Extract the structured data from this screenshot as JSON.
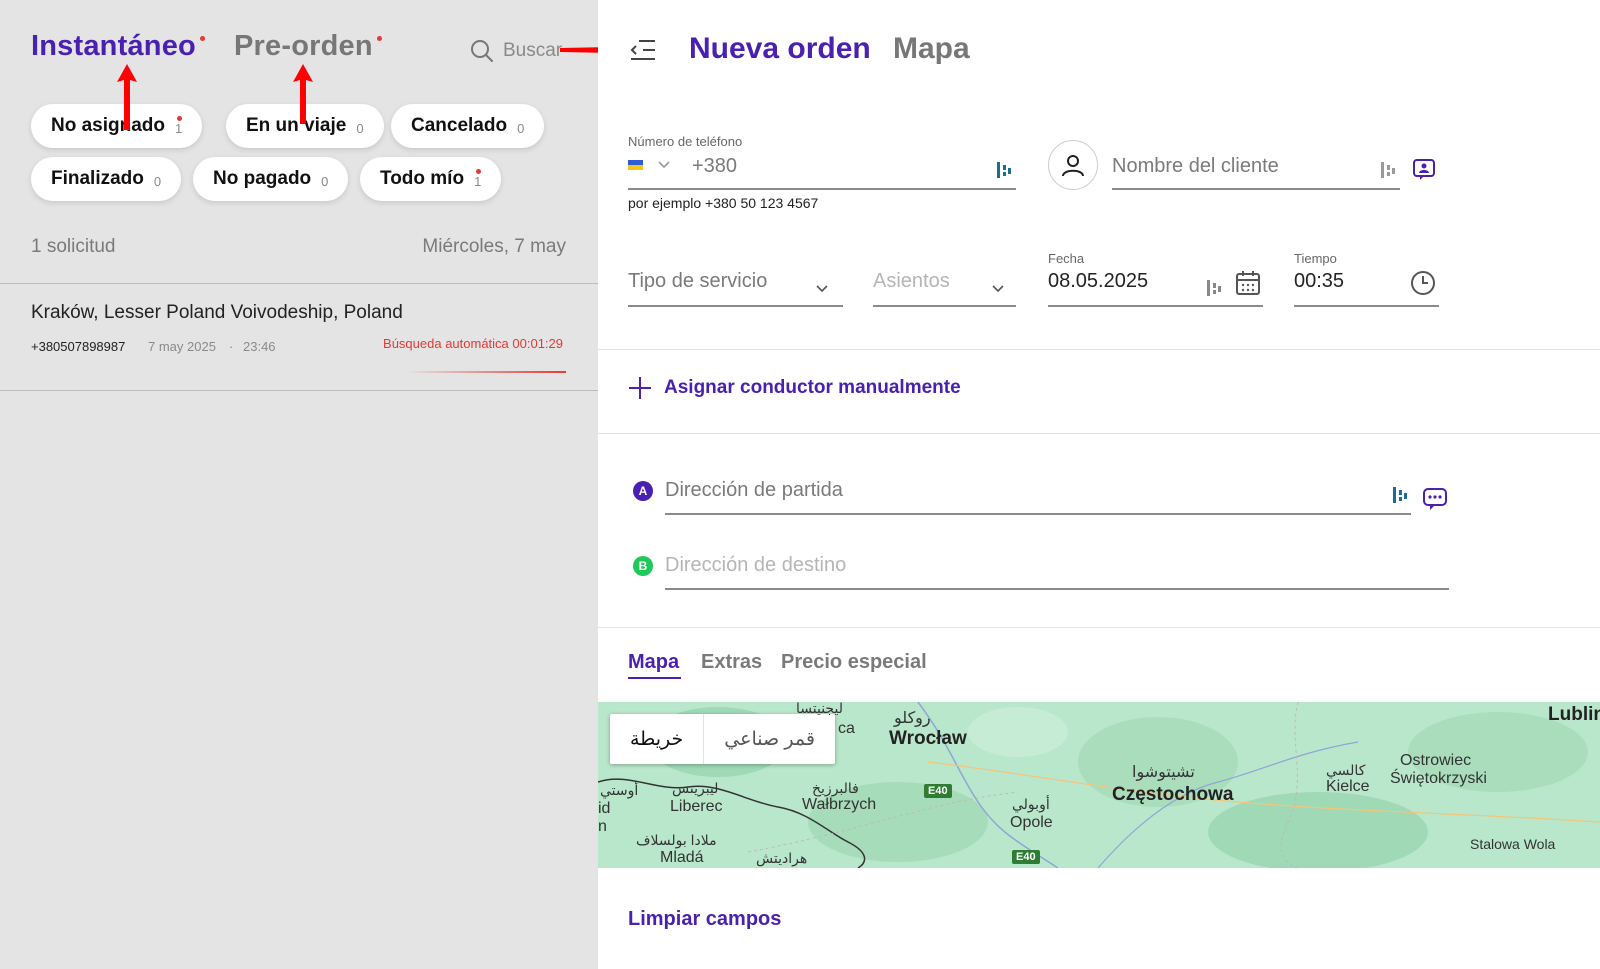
{
  "left": {
    "tabs": {
      "instant": "Instantáneo",
      "preorder": "Pre-orden"
    },
    "search_label": "Buscar",
    "filters": [
      {
        "label": "No asignado",
        "count": "1"
      },
      {
        "label": "En un viaje",
        "count": "0"
      },
      {
        "label": "Cancelado",
        "count": "0"
      },
      {
        "label": "Finalizado",
        "count": "0"
      },
      {
        "label": "No pagado",
        "count": "0"
      },
      {
        "label": "Todo mío",
        "count": "1"
      }
    ],
    "summary": {
      "count": "1 solicitud",
      "date": "Miércoles, 7 may"
    },
    "order": {
      "address": "Kraków, Lesser Poland Voivodeship, Poland",
      "phone": "+380507898987",
      "date": "7 may 2025",
      "separator": "·",
      "time": "23:46",
      "status": "Búsqueda automática 00:01:29"
    }
  },
  "right": {
    "title": "Nueva orden",
    "map_title": "Mapa",
    "phone": {
      "label": "Número de teléfono",
      "placeholder": "+380",
      "hint": "por ejemplo +380 50 123 4567"
    },
    "client_name_placeholder": "Nombre del cliente",
    "service_type_placeholder": "Tipo de servicio",
    "seats_placeholder": "Asientos",
    "date": {
      "label": "Fecha",
      "value": "08.05.2025"
    },
    "time": {
      "label": "Tiempo",
      "value": "00:35"
    },
    "assign_label": "Asignar conductor manualmente",
    "pickup": {
      "badge": "A",
      "placeholder": "Dirección de partida"
    },
    "destination": {
      "badge": "B",
      "placeholder": "Dirección de destino"
    },
    "subtabs": [
      "Mapa",
      "Extras",
      "Precio especial"
    ],
    "map": {
      "type_map": "خريطة",
      "type_satellite": "قمر صناعي",
      "labels": {
        "wroclaw_ar": "روكلو",
        "wroclaw": "Wrocław",
        "legnica_ar": "ليجنيتسا",
        "ca": "ca",
        "lublin": "Lublin",
        "walbrzych_ar": "فالبرزيخ",
        "walbrzych": "Wałbrzych",
        "liberec_ar": "ليبريتس",
        "liberec": "Liberec",
        "ustinad_ar": "أوستي",
        "id": "id",
        "n": "n",
        "mlada_ar": "ملادا بولسلاف",
        "mlada": "Mladá",
        "hradec_ar": "هراديتش",
        "opole_ar": "أوبولي",
        "opole": "Opole",
        "czest_ar": "تشيتوشوا",
        "czest": "Częstochowa",
        "kielce_ar": "كالسي",
        "kielce": "Kielce",
        "ostrowiec": "Ostrowiec",
        "swietokrzyski": "Świętokrzyski",
        "stalowa": "Stalowa Wola",
        "e40a": "E40",
        "e40b": "E40"
      }
    },
    "clear_label": "Limpiar campos"
  },
  "colors": {
    "accent": "#4a20b0",
    "alert": "#e53935",
    "pin_a": "#4a20b0",
    "pin_b": "#1ec95a"
  }
}
